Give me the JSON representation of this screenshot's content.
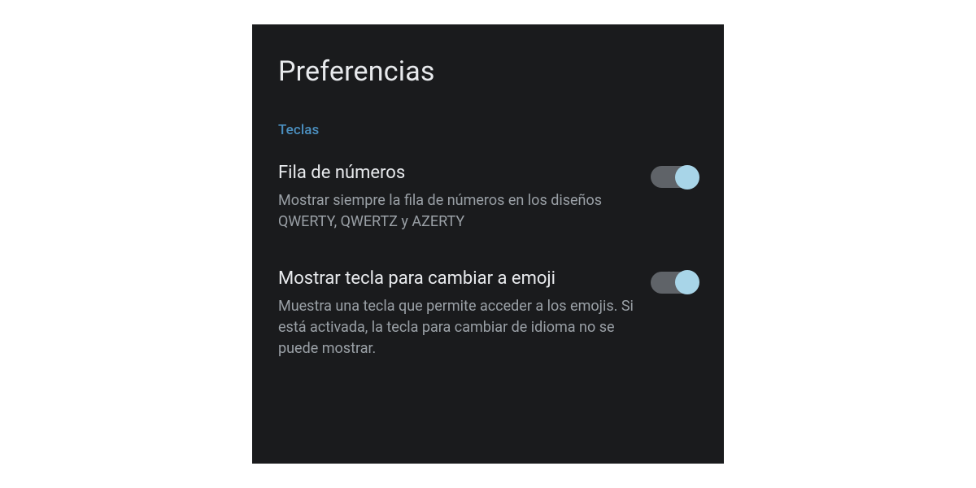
{
  "header": {
    "title": "Preferencias"
  },
  "sections": {
    "teclas": {
      "label": "Teclas",
      "settings": [
        {
          "title": "Fila de números",
          "description": "Mostrar siempre la fila de números en los diseños QWERTY, QWERTZ y AZERTY",
          "enabled": true
        },
        {
          "title": "Mostrar tecla para cambiar a emoji",
          "description": "Muestra una tecla que permite acceder a los emojis. Si está activada, la tecla para cambiar de idioma no se puede mostrar.",
          "enabled": true
        }
      ]
    }
  }
}
